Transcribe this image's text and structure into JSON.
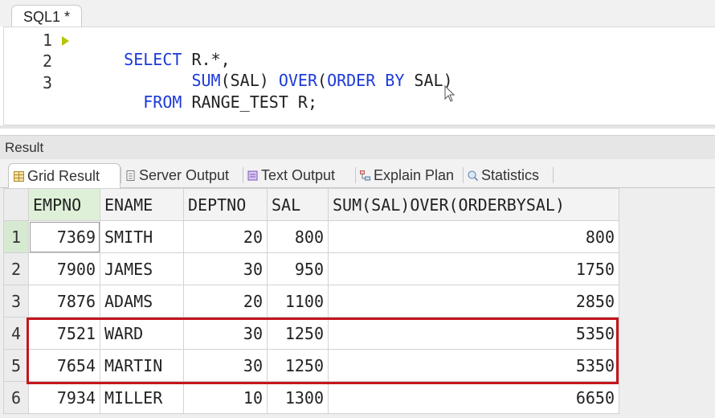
{
  "editor": {
    "tab_label": "SQL1 *",
    "lines": [
      {
        "number": "1",
        "code": [
          {
            "t": "SELECT",
            "kw": true
          },
          {
            "t": " R.*,",
            "kw": false
          }
        ]
      },
      {
        "number": "2",
        "code": [
          {
            "t": "       SUM",
            "kw": true
          },
          {
            "t": "(SAL) ",
            "kw": false
          },
          {
            "t": "OVER",
            "kw": true
          },
          {
            "t": "(",
            "kw": false
          },
          {
            "t": "ORDER BY",
            "kw": true
          },
          {
            "t": " SAL)",
            "kw": false
          }
        ]
      },
      {
        "number": "3",
        "code": [
          {
            "t": "  FROM",
            "kw": true
          },
          {
            "t": " RANGE_TEST R;",
            "kw": false
          }
        ]
      }
    ],
    "keyword_color": "#1c3ad8"
  },
  "result": {
    "title": "Result",
    "tabs": [
      {
        "label": "Grid Result",
        "icon": "grid-icon",
        "active": true
      },
      {
        "label": "Server Output",
        "icon": "server-output-icon",
        "active": false
      },
      {
        "label": "Text Output",
        "icon": "text-output-icon",
        "active": false
      },
      {
        "label": "Explain Plan",
        "icon": "explain-plan-icon",
        "active": false
      },
      {
        "label": "Statistics",
        "icon": "statistics-icon",
        "active": false
      }
    ]
  },
  "grid": {
    "columns": [
      "EMPNO",
      "ENAME",
      "DEPTNO",
      "SAL",
      "SUM(SAL)OVER(ORDERBYSAL)"
    ],
    "rows": [
      {
        "n": "1",
        "cells": [
          "7369",
          "SMITH",
          "20",
          "800",
          "800"
        ]
      },
      {
        "n": "2",
        "cells": [
          "7900",
          "JAMES",
          "30",
          "950",
          "1750"
        ]
      },
      {
        "n": "3",
        "cells": [
          "7876",
          "ADAMS",
          "20",
          "1100",
          "2850"
        ]
      },
      {
        "n": "4",
        "cells": [
          "7521",
          "WARD",
          "30",
          "1250",
          "5350"
        ]
      },
      {
        "n": "5",
        "cells": [
          "7654",
          "MARTIN",
          "30",
          "1250",
          "5350"
        ]
      },
      {
        "n": "6",
        "cells": [
          "7934",
          "MILLER",
          "10",
          "1300",
          "6650"
        ]
      }
    ],
    "highlighted_rows": [
      "4",
      "5"
    ],
    "highlight_color": "#c4161c",
    "selected_header_color": "#dff0d8"
  }
}
